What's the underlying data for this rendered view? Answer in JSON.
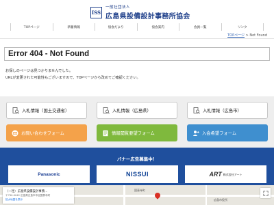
{
  "header": {
    "logo_mark": "ISS",
    "org_type": "一般社団法人",
    "org_name": "広島県設備設計事務所協会"
  },
  "nav": {
    "items": [
      {
        "label": "TOPページ"
      },
      {
        "label": "新着情報"
      },
      {
        "label": "協会だより"
      },
      {
        "label": "協会案内"
      },
      {
        "label": "会員一覧"
      },
      {
        "label": "リンク"
      }
    ]
  },
  "breadcrumb": {
    "home": "TOPページ",
    "separator": ">",
    "current": "Not Found"
  },
  "error": {
    "title": "Error 404 - Not Found",
    "message_1": "お探しのページは見つかりませんでした。",
    "message_2": "URLが変更された可能性もございますので、TOPページから改めてご確認ください。"
  },
  "buttons": {
    "bid_mlit": "入札情報（国土交通省）",
    "bid_pref": "入札情報（広島県）",
    "bid_city": "入札情報（広島市）",
    "contact": "お問い合わせフォーム",
    "info_request": "情報閲覧要望フォーム",
    "join_request": "入会希望フォーム"
  },
  "banner": {
    "title": "バナー広告募集中！",
    "ads": [
      {
        "name": "Panasonic"
      },
      {
        "name": "NISSUI"
      },
      {
        "name": "ART",
        "sub": "株式会社アート"
      }
    ]
  },
  "map": {
    "card_title": "（一社）広島県設備設計事務...",
    "card_address": "〒730-0042 広島県広島市中区国泰寺町",
    "card_link": "拡大地図を表示",
    "label_1": "国泰寺町",
    "label_2": "広島市役所"
  },
  "colors": {
    "brand_navy": "#1e3f8a",
    "banner_blue": "#1f4f9d",
    "contact_orange": "#f4a24a",
    "info_green": "#7fb93d",
    "join_blue": "#3f8fcf",
    "section_gray": "#eeeeee"
  }
}
